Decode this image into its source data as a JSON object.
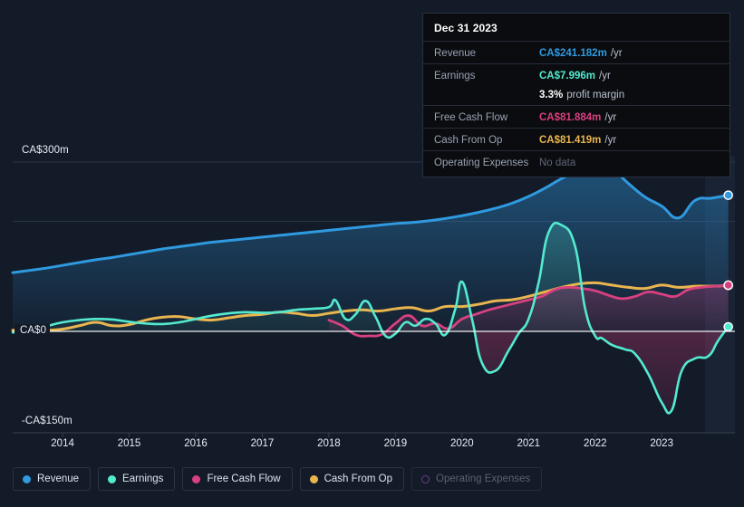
{
  "colors": {
    "revenue": "#2f9ae0",
    "earnings": "#53ead0",
    "free_cash_flow": "#d8407f",
    "cash_from_op": "#eab54f",
    "operating_expenses": "#6c3f86",
    "background": "#131a28",
    "zero_line": "#ffffff"
  },
  "tooltip": {
    "title": "Dec 31 2023",
    "rows": [
      {
        "label": "Revenue",
        "value": "CA$241.182m",
        "suffix": "/yr",
        "color": "#2f9ae0"
      },
      {
        "label": "Earnings",
        "value": "CA$7.996m",
        "suffix": "/yr",
        "color": "#53ead0"
      },
      {
        "label": "",
        "value": "3.3%",
        "suffix": "profit margin",
        "color": "#ffffff"
      },
      {
        "label": "Free Cash Flow",
        "value": "CA$81.884m",
        "suffix": "/yr",
        "color": "#d8407f"
      },
      {
        "label": "Cash From Op",
        "value": "CA$81.419m",
        "suffix": "/yr",
        "color": "#eab54f"
      },
      {
        "label": "Operating Expenses",
        "value": "No data",
        "suffix": "",
        "color": "#5e6675"
      }
    ]
  },
  "legend": [
    {
      "label": "Revenue",
      "color": "#2f9ae0",
      "enabled": true
    },
    {
      "label": "Earnings",
      "color": "#53ead0",
      "enabled": true
    },
    {
      "label": "Free Cash Flow",
      "color": "#d8407f",
      "enabled": true
    },
    {
      "label": "Cash From Op",
      "color": "#eab54f",
      "enabled": true
    },
    {
      "label": "Operating Expenses",
      "color": "#6c3f86",
      "enabled": false
    }
  ],
  "chart_data": {
    "type": "area",
    "title": "",
    "xlabel": "",
    "ylabel": "",
    "currency": "CA$",
    "units": "millions",
    "grid": true,
    "legend_position": "bottom",
    "ylim": [
      -150,
      300
    ],
    "y_ticks": [
      {
        "value": 300,
        "label": "CA$300m"
      },
      {
        "value": 0,
        "label": "CA$0"
      },
      {
        "value": -150,
        "label": "-CA$150m"
      }
    ],
    "gridlines": [
      300,
      195,
      0
    ],
    "x_ticks": [
      "2014",
      "2015",
      "2016",
      "2017",
      "2018",
      "2019",
      "2020",
      "2021",
      "2022",
      "2023"
    ],
    "xlim": [
      2013.25,
      2024.1
    ],
    "series": [
      {
        "name": "Revenue",
        "color": "#2f9ae0",
        "last_value": 241.182,
        "x": [
          2013.25,
          2013.5,
          2013.75,
          2014,
          2014.25,
          2014.5,
          2014.75,
          2015,
          2015.25,
          2015.5,
          2015.75,
          2016,
          2016.25,
          2016.5,
          2016.75,
          2017,
          2017.25,
          2017.5,
          2017.75,
          2018,
          2018.25,
          2018.5,
          2018.75,
          2019,
          2019.25,
          2019.5,
          2019.75,
          2020,
          2020.25,
          2020.5,
          2020.75,
          2021,
          2021.25,
          2021.5,
          2021.75,
          2022,
          2022.25,
          2022.5,
          2022.75,
          2023,
          2023.25,
          2023.5,
          2023.75,
          2024
        ],
        "values": [
          104,
          108,
          112,
          117,
          122,
          127,
          131,
          136,
          141,
          146,
          150,
          154,
          158,
          161,
          164,
          167,
          170,
          173,
          176,
          179,
          182,
          185,
          188,
          191,
          193,
          196,
          200,
          205,
          211,
          218,
          227,
          239,
          254,
          271,
          285,
          296,
          288,
          262,
          238,
          222,
          201,
          232,
          236,
          241.182
        ]
      },
      {
        "name": "Earnings",
        "color": "#53ead0",
        "last_value": 7.996,
        "x": [
          2013.25,
          2013.5,
          2013.75,
          2014,
          2014.25,
          2014.5,
          2014.75,
          2015,
          2015.25,
          2015.5,
          2015.75,
          2016,
          2016.25,
          2016.5,
          2016.75,
          2017,
          2017.25,
          2017.5,
          2017.75,
          2018,
          2018.1,
          2018.25,
          2018.4,
          2018.55,
          2018.7,
          2018.85,
          2019,
          2019.15,
          2019.3,
          2019.45,
          2019.6,
          2019.75,
          2019.9,
          2020,
          2020.15,
          2020.3,
          2020.5,
          2020.7,
          2020.85,
          2021,
          2021.15,
          2021.3,
          2021.5,
          2021.7,
          2021.85,
          2022,
          2022.1,
          2022.25,
          2022.45,
          2022.6,
          2022.8,
          2023,
          2023.15,
          2023.3,
          2023.5,
          2023.7,
          2023.85,
          2024
        ],
        "values": [
          -2,
          2,
          9,
          16,
          20,
          22,
          21,
          17,
          14,
          13,
          16,
          22,
          28,
          32,
          34,
          33,
          34,
          38,
          40,
          43,
          55,
          22,
          30,
          54,
          26,
          -8,
          -4,
          16,
          10,
          22,
          14,
          -6,
          40,
          88,
          22,
          -56,
          -70,
          -34,
          -4,
          22,
          86,
          175,
          188,
          150,
          40,
          -8,
          -12,
          -24,
          -32,
          -40,
          -76,
          -126,
          -140,
          -70,
          -48,
          -44,
          -16,
          7.996
        ]
      },
      {
        "name": "Free Cash Flow",
        "color": "#d8407f",
        "last_value": 81.884,
        "x": [
          2018,
          2018.2,
          2018.4,
          2018.6,
          2018.8,
          2019,
          2019.2,
          2019.4,
          2019.6,
          2019.8,
          2020,
          2020.2,
          2020.4,
          2020.6,
          2020.8,
          2021,
          2021.2,
          2021.4,
          2021.6,
          2021.8,
          2022,
          2022.2,
          2022.4,
          2022.6,
          2022.8,
          2023,
          2023.2,
          2023.4,
          2023.6,
          2023.8,
          2024
        ],
        "values": [
          20,
          10,
          -6,
          -8,
          -5,
          14,
          28,
          10,
          14,
          5,
          22,
          30,
          38,
          44,
          50,
          56,
          62,
          74,
          78,
          76,
          72,
          64,
          58,
          62,
          70,
          66,
          62,
          74,
          78,
          80,
          81.884
        ]
      },
      {
        "name": "Cash From Op",
        "color": "#eab54f",
        "last_value": 81.419,
        "x": [
          2013.25,
          2013.5,
          2013.75,
          2014,
          2014.25,
          2014.5,
          2014.75,
          2015,
          2015.25,
          2015.5,
          2015.75,
          2016,
          2016.25,
          2016.5,
          2016.75,
          2017,
          2017.25,
          2017.5,
          2017.75,
          2018,
          2018.25,
          2018.5,
          2018.75,
          2019,
          2019.25,
          2019.5,
          2019.75,
          2020,
          2020.25,
          2020.5,
          2020.75,
          2021,
          2021.25,
          2021.5,
          2021.75,
          2022,
          2022.25,
          2022.5,
          2022.75,
          2023,
          2023.25,
          2023.5,
          2023.75,
          2024
        ],
        "values": [
          2,
          3,
          2,
          4,
          10,
          16,
          10,
          12,
          20,
          25,
          26,
          22,
          20,
          24,
          28,
          30,
          34,
          32,
          28,
          32,
          36,
          38,
          36,
          40,
          42,
          36,
          44,
          44,
          48,
          54,
          56,
          62,
          70,
          78,
          84,
          86,
          82,
          78,
          76,
          82,
          78,
          80,
          80,
          81.419
        ]
      },
      {
        "name": "Operating Expenses",
        "color": "#6c3f86",
        "last_value": null,
        "x": [],
        "values": []
      }
    ],
    "highlight_band": {
      "from": 2023.65,
      "to": 2024.1
    }
  }
}
